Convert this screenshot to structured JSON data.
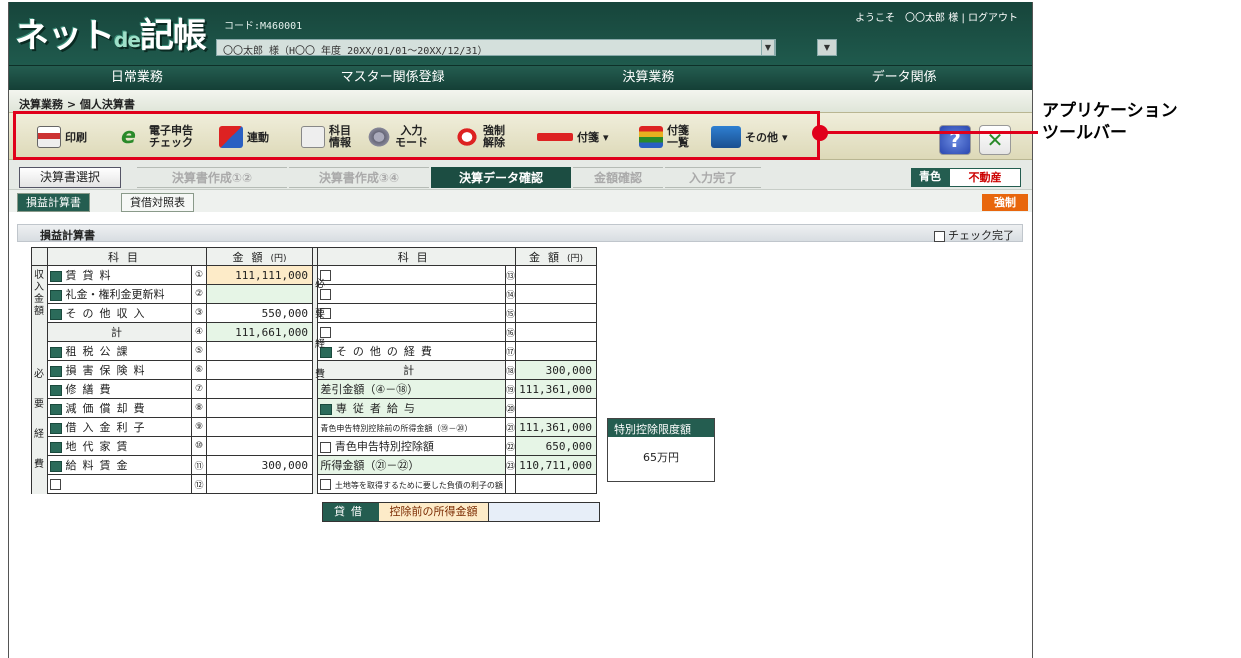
{
  "header": {
    "logo_main": "ネット",
    "logo_de": "de",
    "logo_tail": "記帳",
    "code_label": "コード:M460001",
    "user_info": "〇〇太郎 様（H〇〇 年度 20XX/01/01～20XX/12/31）",
    "welcome": "ようこそ　〇〇太郎 様",
    "logout": "ログアウト",
    "sep": "|"
  },
  "menu": [
    "日常業務",
    "マスター関係登録",
    "決算業務",
    "データ関係"
  ],
  "breadcrumb": "決算業務 > 個人決算書",
  "toolbar": {
    "print": "印刷",
    "echeck_1": "電子申告",
    "echeck_2": "チェック",
    "link": "連動",
    "kamoku_1": "科目",
    "kamoku_2": "情報",
    "input_1": "入力",
    "input_2": "モード",
    "force_1": "強制",
    "force_2": "解除",
    "fusen": "付箋",
    "fusen_list_1": "付箋",
    "fusen_list_2": "一覧",
    "other": "その他",
    "help": "?",
    "close": "✕"
  },
  "steps": {
    "select": "決算書選択",
    "items": [
      "決算書作成①②",
      "決算書作成③④",
      "決算データ確認",
      "金額確認",
      "入力完了"
    ],
    "blue": "青色",
    "property": "不動産"
  },
  "tabs": {
    "pl": "損益計算書",
    "bs": "貸借対照表",
    "force": "強制"
  },
  "section": {
    "title": "損益計算書",
    "check_done": "チェック完了"
  },
  "table_headers": {
    "kamoku": "科目",
    "kingaku": "金額",
    "unit": "(円)"
  },
  "left_groups": {
    "income": "収入金額",
    "expense": "必要経費"
  },
  "left_rows": [
    {
      "no": "①",
      "label": "賃貸料",
      "value": "111,111,000"
    },
    {
      "no": "②",
      "label": "礼金・権利金更新料",
      "value": ""
    },
    {
      "no": "③",
      "label": "その他収入",
      "value": "550,000"
    },
    {
      "no": "④",
      "label": "計",
      "value": "111,661,000"
    },
    {
      "no": "⑤",
      "label": "租税公課",
      "value": ""
    },
    {
      "no": "⑥",
      "label": "損害保険料",
      "value": ""
    },
    {
      "no": "⑦",
      "label": "修繕費",
      "value": ""
    },
    {
      "no": "⑧",
      "label": "減価償却費",
      "value": ""
    },
    {
      "no": "⑨",
      "label": "借入金利子",
      "value": ""
    },
    {
      "no": "⑩",
      "label": "地代家賃",
      "value": ""
    },
    {
      "no": "⑪",
      "label": "給料賃金",
      "value": "300,000"
    },
    {
      "no": "⑫",
      "label": "",
      "value": ""
    }
  ],
  "right_rows": [
    {
      "no": "⑬",
      "label": "",
      "value": ""
    },
    {
      "no": "⑭",
      "label": "",
      "value": ""
    },
    {
      "no": "⑮",
      "label": "",
      "value": ""
    },
    {
      "no": "⑯",
      "label": "",
      "value": ""
    },
    {
      "no": "⑰",
      "label": "その他の経費",
      "value": ""
    },
    {
      "no": "⑱",
      "label": "計",
      "value": "300,000"
    },
    {
      "no": "⑲",
      "label": "差引金額（④－⑱）",
      "value": "111,361,000"
    },
    {
      "no": "⑳",
      "label": "専従者給与",
      "value": ""
    },
    {
      "no": "㉑",
      "label": "青色申告特別控除前の所得金額（⑲－⑳）",
      "value": "111,361,000"
    },
    {
      "no": "㉒",
      "label": "青色申告特別控除額",
      "value": "650,000"
    },
    {
      "no": "㉓",
      "label": "所得金額（㉑－㉒）",
      "value": "110,711,000"
    },
    {
      "no": "",
      "label": "土地等を取得するために要した負債の利子の額",
      "value": ""
    }
  ],
  "right_group": "必要経費",
  "special": {
    "title": "特別控除限度額",
    "value": "65万円"
  },
  "bottom": {
    "a": "貸借",
    "b": "控除前の所得金額",
    "c": ""
  },
  "callout": [
    "アプリケーション",
    "ツールバー"
  ],
  "colors": {
    "accent_green": "#245d50",
    "highlight_red": "#e0001b",
    "force_orange": "#e8660d"
  }
}
